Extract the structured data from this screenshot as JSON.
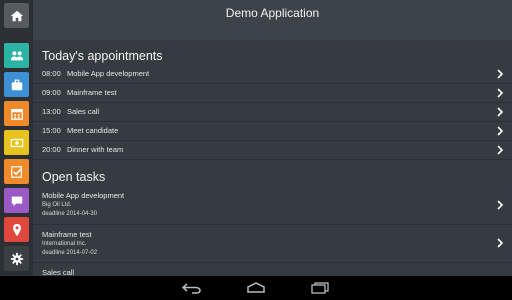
{
  "header": {
    "title": "Demo Application"
  },
  "sidebar": {
    "items": [
      {
        "icon": "home-icon",
        "color": "#555b60"
      },
      {
        "icon": "people-icon",
        "color": "#2bb4a6"
      },
      {
        "icon": "briefcase-icon",
        "color": "#3d8fd6"
      },
      {
        "icon": "calendar-icon",
        "color": "#ee8a2a"
      },
      {
        "icon": "money-icon",
        "color": "#e8c31e"
      },
      {
        "icon": "checklist-icon",
        "color": "#ef8b2b"
      },
      {
        "icon": "chat-icon",
        "color": "#9b59c6"
      },
      {
        "icon": "map-pin-icon",
        "color": "#e0483e"
      },
      {
        "icon": "gear-icon",
        "color": "#3a3f43"
      }
    ]
  },
  "appointments": {
    "title": "Today's appointments",
    "items": [
      {
        "time": "08:00",
        "text": "Mobile App development"
      },
      {
        "time": "09:00",
        "text": "Mainframe test"
      },
      {
        "time": "13:00",
        "text": "Sales call"
      },
      {
        "time": "15:00",
        "text": "Meet candidate"
      },
      {
        "time": "20:00",
        "text": "Dinner with team"
      }
    ]
  },
  "tasks": {
    "title": "Open tasks",
    "items": [
      {
        "title": "Mobile App development",
        "company": "Big Oil Ltd.",
        "deadline": "deadline 2014-04-30"
      },
      {
        "title": "Mainframe test",
        "company": "International Inc.",
        "deadline": "deadline 2014-07-02"
      },
      {
        "title": "Sales call",
        "company": "",
        "deadline": ""
      }
    ]
  },
  "navbar": {
    "icons": [
      "back-icon",
      "home-nav-icon",
      "recents-icon"
    ]
  }
}
